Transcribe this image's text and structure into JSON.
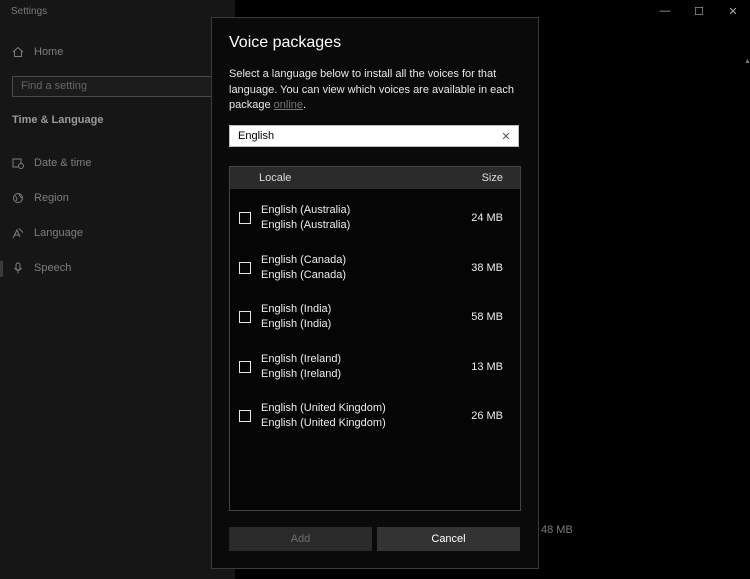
{
  "app": {
    "title": "Settings"
  },
  "sidebar": {
    "home_label": "Home",
    "search_placeholder": "Find a setting",
    "section_heading": "Time & Language",
    "items": [
      {
        "label": "Date & time",
        "icon": "calendar-clock-icon"
      },
      {
        "label": "Region",
        "icon": "globe-icon"
      },
      {
        "label": "Language",
        "icon": "language-icon"
      },
      {
        "label": "Speech",
        "icon": "microphone-icon"
      }
    ]
  },
  "background": {
    "size_text": "48 MB"
  },
  "dialog": {
    "title": "Voice packages",
    "description": "Select a language below to install all the voices for that language. You can view which voices are available in each package ",
    "link_text": "online",
    "description_end": ".",
    "filter_value": "English",
    "columns": {
      "locale": "Locale",
      "size": "Size"
    },
    "packages": [
      {
        "name": "English (Australia)",
        "subname": "English (Australia)",
        "size": "24 MB",
        "checked": false
      },
      {
        "name": "English (Canada)",
        "subname": "English (Canada)",
        "size": "38 MB",
        "checked": false
      },
      {
        "name": "English (India)",
        "subname": "English (India)",
        "size": "58 MB",
        "checked": false
      },
      {
        "name": "English (Ireland)",
        "subname": "English (Ireland)",
        "size": "13 MB",
        "checked": false
      },
      {
        "name": "English (United Kingdom)",
        "subname": "English (United Kingdom)",
        "size": "26 MB",
        "checked": false
      }
    ],
    "add_label": "Add",
    "cancel_label": "Cancel"
  }
}
